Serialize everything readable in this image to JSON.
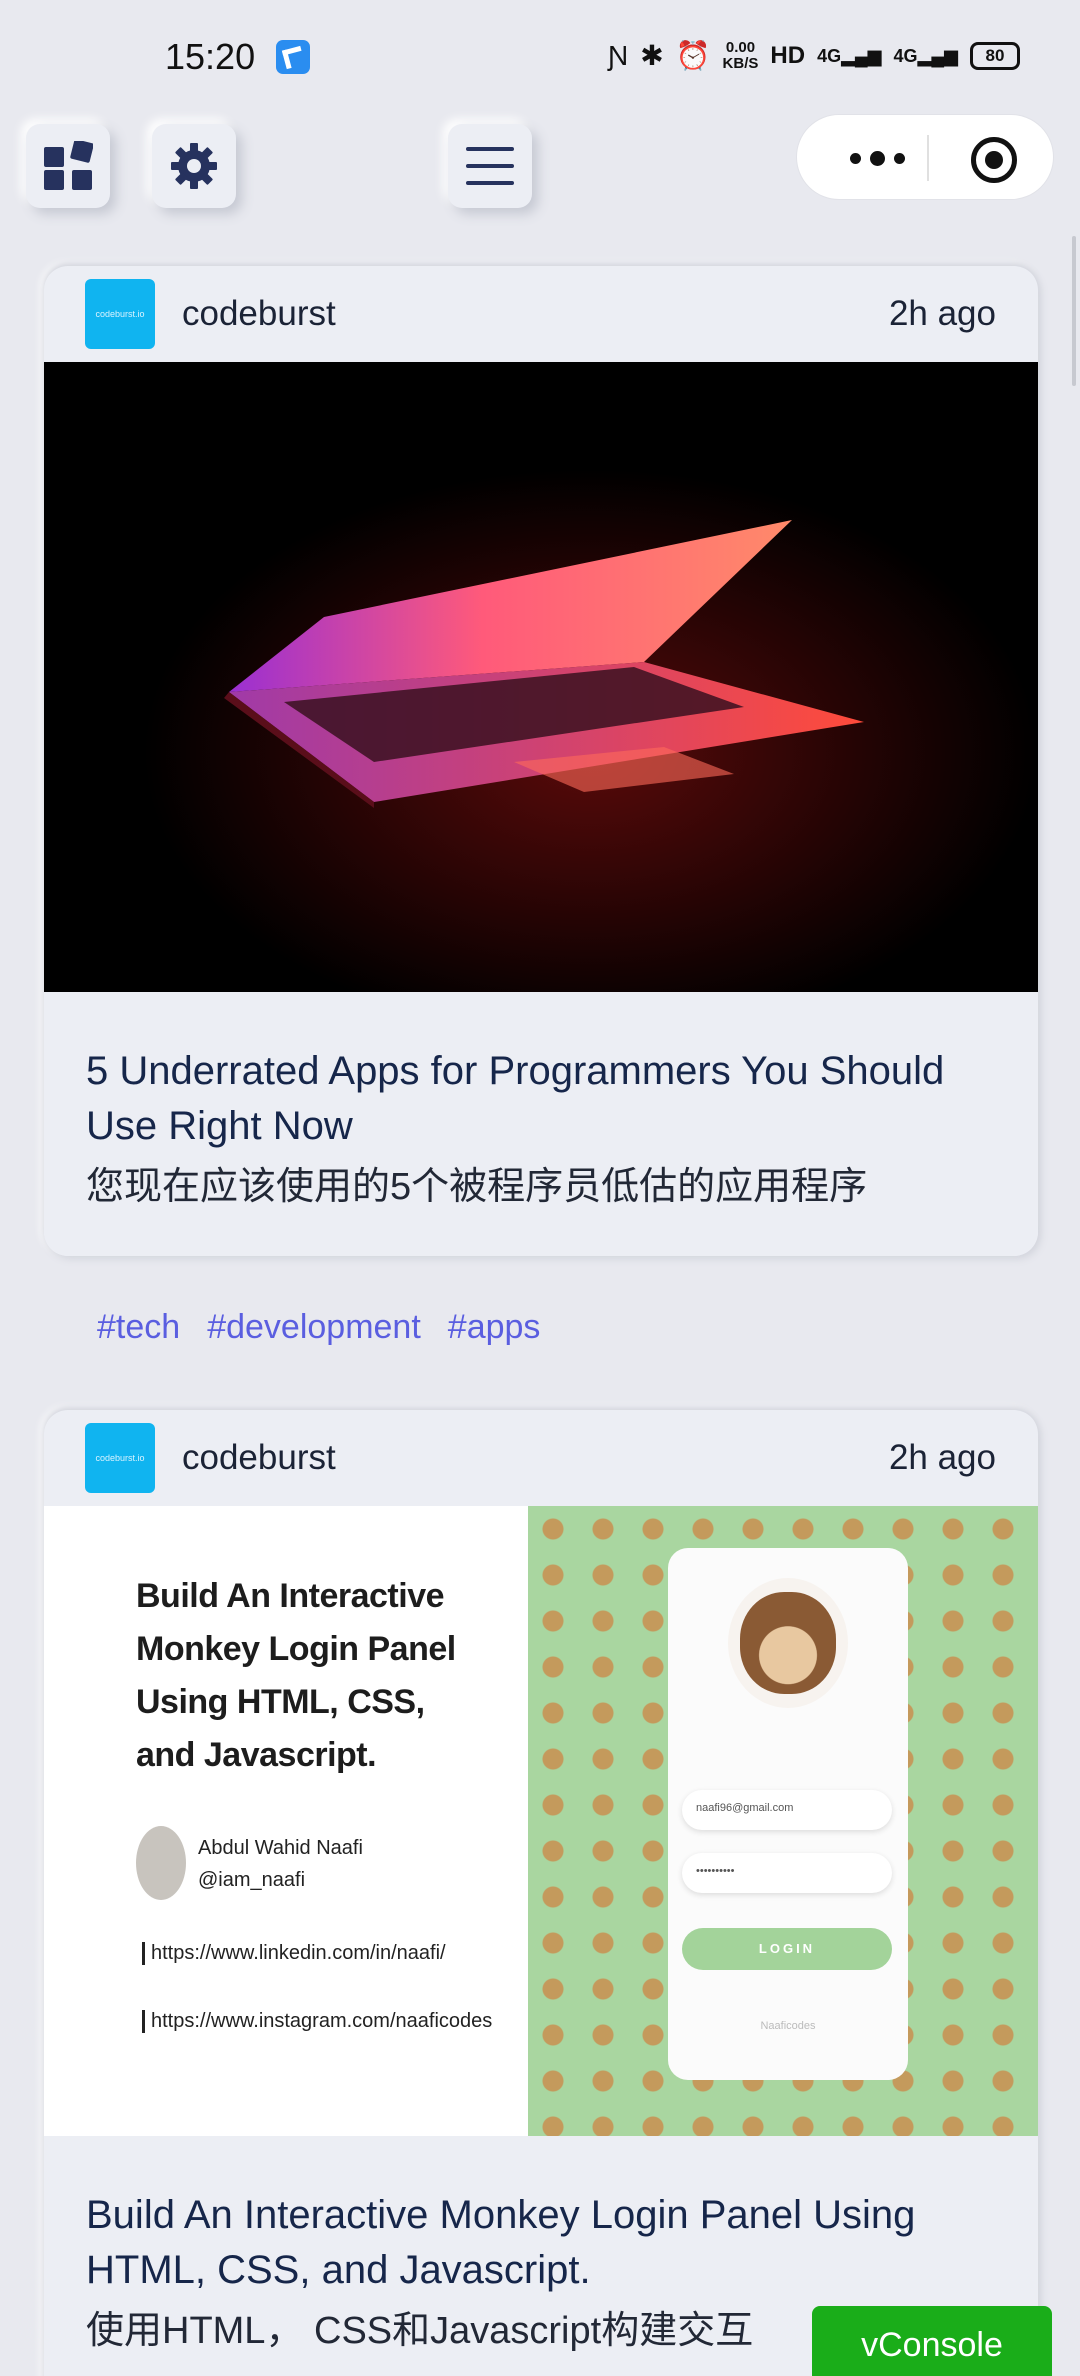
{
  "status_bar": {
    "time": "15:20",
    "net_speed_value": "0.00",
    "net_speed_unit": "KB/S",
    "hd_label": "HD",
    "signal_1": "4G",
    "signal_2": "4G",
    "battery": "80"
  },
  "toolbar": {
    "apps_icon": "grid-apps-icon",
    "settings_icon": "gear-icon",
    "menu_icon": "hamburger-menu-icon",
    "more_icon": "more-dots-icon",
    "close_icon": "target-close-icon"
  },
  "articles": [
    {
      "source": "codeburst",
      "logo_text": "codeburst.io",
      "time": "2h ago",
      "title": "5 Underrated Apps for Programmers You Should Use Right Now",
      "subtitle": "您现在应该使用的5个被程序员低估的应用程序",
      "tags": [
        "#tech",
        "#development",
        "#apps"
      ]
    },
    {
      "source": "codeburst",
      "logo_text": "codeburst.io",
      "time": "2h ago",
      "title": "Build An Interactive Monkey Login Panel Using HTML, CSS, and Javascript.",
      "subtitle": "使用HTML， CSS和Javascript构建交互",
      "image_text": {
        "headline": "Build An Interactive Monkey Login Panel Using HTML, CSS, and Javascript.",
        "author_name": "Abdul Wahid Naafi",
        "author_handle": "@iam_naafi",
        "link_1": "https://www.linkedin.com/in/naafi/",
        "link_2": "https://www.instagram.com/naaficodes",
        "email": "naafi96@gmail.com",
        "password": "••••••••••",
        "login_button": "LOGIN",
        "footer": "Naaficodes"
      }
    }
  ],
  "vconsole": {
    "label": "vConsole",
    "color": "#1aad19"
  },
  "colors": {
    "background": "#e8e9ef",
    "tag": "#5a5ee0",
    "logo": "#10b4f0"
  }
}
